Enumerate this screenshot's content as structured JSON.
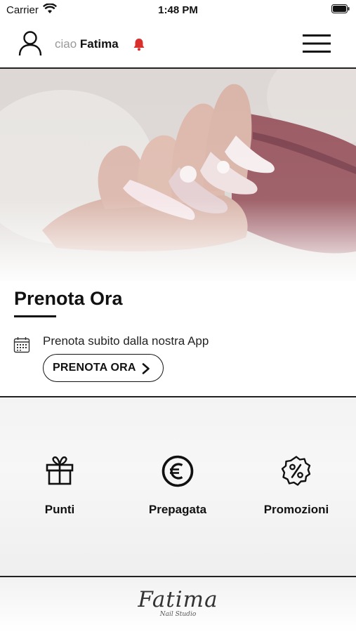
{
  "status_bar": {
    "carrier": "Carrier",
    "time": "1:48 PM"
  },
  "header": {
    "greeting": "ciao",
    "user_name": "Fatima"
  },
  "booking_card": {
    "title": "Prenota Ora",
    "description": "Prenota subito dalla nostra App",
    "button_label": "PRENOTA ORA"
  },
  "features": [
    {
      "label": "Punti",
      "icon": "gift-icon"
    },
    {
      "label": "Prepagata",
      "icon": "euro-coin-icon"
    },
    {
      "label": "Promozioni",
      "icon": "discount-badge-icon"
    }
  ],
  "footer": {
    "logo_text": "Fatima",
    "logo_subtitle": "Nail Studio"
  },
  "colors": {
    "accent_bell": "#d9302e",
    "text": "#111111",
    "divider": "#222222"
  }
}
